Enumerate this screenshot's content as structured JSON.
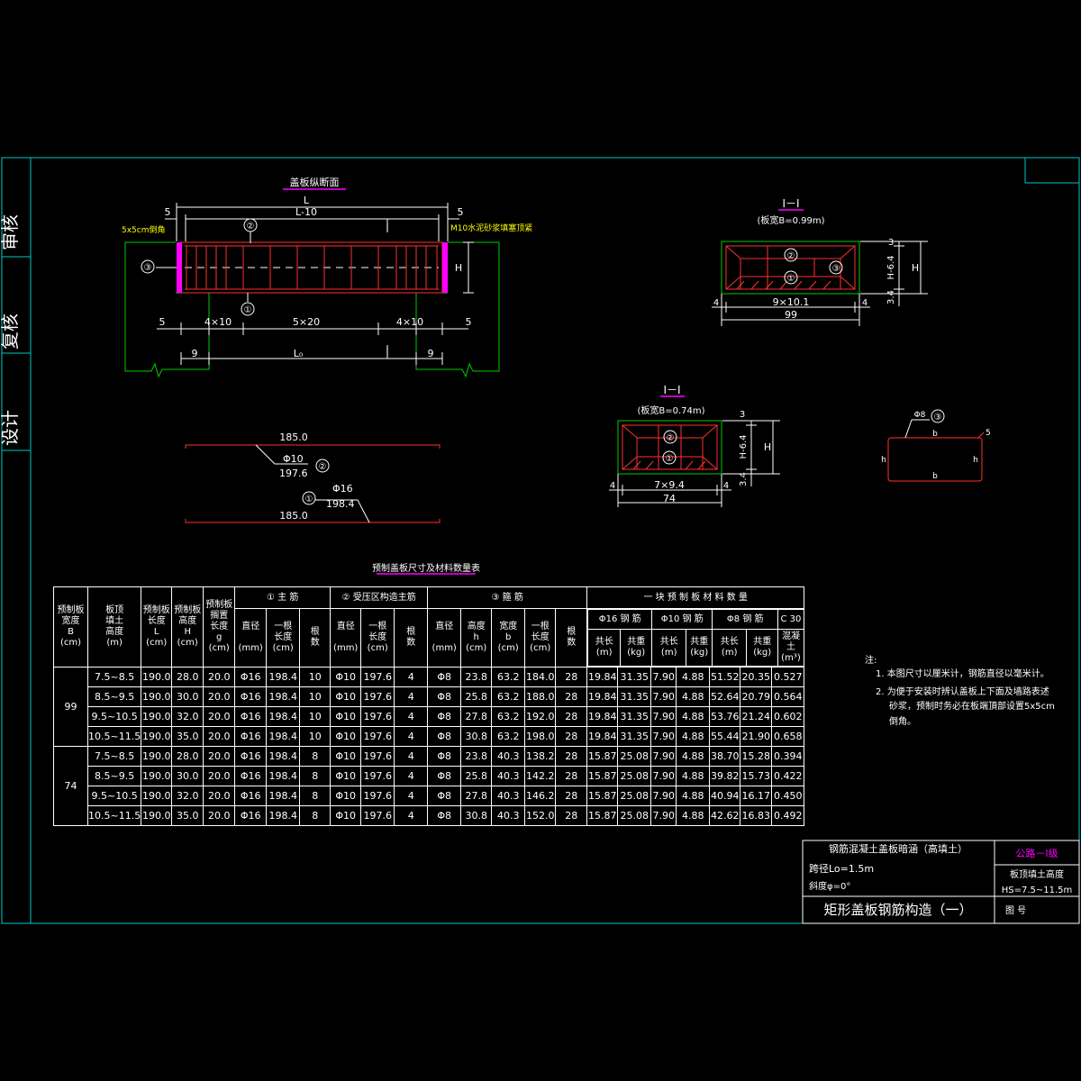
{
  "sidebar": {
    "review": "审核",
    "recheck": "复核",
    "design": "设计"
  },
  "longitudinal": {
    "title": "盖板纵断面",
    "L": "L",
    "L_minus_10": "L-10",
    "left_5": "5",
    "right_5": "5",
    "chamfer_note": "5x5cm倒角",
    "mortar_note": "M10水泥砂浆填塞顶紧",
    "section_mark": "I",
    "H": "H",
    "c1": "①",
    "c2": "②",
    "c3": "③",
    "dim_5a": "5",
    "dim_4x10a": "4×10",
    "dim_5x20": "5×20",
    "dim_4x10b": "4×10",
    "dim_5b": "5",
    "dim_9a": "9",
    "dim_L0": "L₀",
    "dim_9b": "9"
  },
  "sectionA": {
    "title": "I－I",
    "width_note": "(板宽B=0.99m)",
    "d3": "3",
    "dH64": "H-6.4",
    "d34": "3.4",
    "dH": "H",
    "d4a": "4",
    "d9x101": "9×10.1",
    "d4b": "4",
    "d99": "99",
    "c1": "①",
    "c2": "②",
    "c3": "③"
  },
  "sectionB": {
    "title": "I－I",
    "width_note": "(板宽B=0.74m)",
    "d3": "3",
    "dH64": "H-6.4",
    "d34": "3.4",
    "dH": "H",
    "d4a": "4",
    "d7x94": "7×9.4",
    "d4b": "4",
    "d74": "74",
    "c1": "①",
    "c2": "②"
  },
  "bars": {
    "b185a": "185.0",
    "b185b": "185.0",
    "phi10": "Φ10",
    "l1976": "197.6",
    "c2": "②",
    "phi16": "Φ16",
    "l1984": "198.4",
    "c1": "①"
  },
  "stirrup": {
    "phi8": "Φ8",
    "c3": "③",
    "b_top": "b",
    "b_bottom": "b",
    "h_left": "h",
    "h_right": "h",
    "five": "5"
  },
  "table": {
    "title": "预制盖板尺寸及材料数量表",
    "header": {
      "col_B": [
        "预制板",
        "宽度",
        "B",
        "(cm)"
      ],
      "col_fill": [
        "板顶",
        "填土",
        "高度",
        "(m)"
      ],
      "col_L": [
        "预制板",
        "长度",
        "L",
        "(cm)"
      ],
      "col_H": [
        "预制板",
        "高度",
        "H",
        "(cm)"
      ],
      "col_g": [
        "预制板",
        "搁置",
        "长度",
        "g",
        "(cm)"
      ],
      "grp_main": "① 主 筋",
      "grp_comp": "② 受压区构造主筋",
      "grp_stir": "③ 箍 筋",
      "grp_mat": "一 块 预 制 板 材 料 数 量",
      "dia": [
        "直径",
        "(mm)"
      ],
      "len1": [
        "一根",
        "长度",
        "(cm)"
      ],
      "count": [
        "根",
        "数"
      ],
      "stir_h": [
        "高度",
        "h",
        "(cm)"
      ],
      "stir_b": [
        "宽度",
        "b",
        "(cm)"
      ],
      "m16": "Φ16  钢 筋",
      "m10": "Φ10  钢 筋",
      "m8": "Φ8  钢 筋",
      "mc": "C 30",
      "total_len": [
        "共长",
        "(m)"
      ],
      "total_wt": [
        "共重",
        "(kg)"
      ],
      "concrete": [
        "混凝土",
        "(m³)"
      ]
    },
    "groups": [
      {
        "B": "99",
        "rows": [
          [
            "7.5~8.5",
            "190.0",
            "28.0",
            "20.0",
            "Φ16",
            "198.4",
            "10",
            "Φ10",
            "197.6",
            "4",
            "Φ8",
            "23.8",
            "63.2",
            "184.0",
            "28",
            "19.84",
            "31.35",
            "7.90",
            "4.88",
            "51.52",
            "20.35",
            "0.527"
          ],
          [
            "8.5~9.5",
            "190.0",
            "30.0",
            "20.0",
            "Φ16",
            "198.4",
            "10",
            "Φ10",
            "197.6",
            "4",
            "Φ8",
            "25.8",
            "63.2",
            "188.0",
            "28",
            "19.84",
            "31.35",
            "7.90",
            "4.88",
            "52.64",
            "20.79",
            "0.564"
          ],
          [
            "9.5~10.5",
            "190.0",
            "32.0",
            "20.0",
            "Φ16",
            "198.4",
            "10",
            "Φ10",
            "197.6",
            "4",
            "Φ8",
            "27.8",
            "63.2",
            "192.0",
            "28",
            "19.84",
            "31.35",
            "7.90",
            "4.88",
            "53.76",
            "21.24",
            "0.602"
          ],
          [
            "10.5~11.5",
            "190.0",
            "35.0",
            "20.0",
            "Φ16",
            "198.4",
            "10",
            "Φ10",
            "197.6",
            "4",
            "Φ8",
            "30.8",
            "63.2",
            "198.0",
            "28",
            "19.84",
            "31.35",
            "7.90",
            "4.88",
            "55.44",
            "21.90",
            "0.658"
          ]
        ]
      },
      {
        "B": "74",
        "rows": [
          [
            "7.5~8.5",
            "190.0",
            "28.0",
            "20.0",
            "Φ16",
            "198.4",
            "8",
            "Φ10",
            "197.6",
            "4",
            "Φ8",
            "23.8",
            "40.3",
            "138.2",
            "28",
            "15.87",
            "25.08",
            "7.90",
            "4.88",
            "38.70",
            "15.28",
            "0.394"
          ],
          [
            "8.5~9.5",
            "190.0",
            "30.0",
            "20.0",
            "Φ16",
            "198.4",
            "8",
            "Φ10",
            "197.6",
            "4",
            "Φ8",
            "25.8",
            "40.3",
            "142.2",
            "28",
            "15.87",
            "25.08",
            "7.90",
            "4.88",
            "39.82",
            "15.73",
            "0.422"
          ],
          [
            "9.5~10.5",
            "190.0",
            "32.0",
            "20.0",
            "Φ16",
            "198.4",
            "8",
            "Φ10",
            "197.6",
            "4",
            "Φ8",
            "27.8",
            "40.3",
            "146.2",
            "28",
            "15.87",
            "25.08",
            "7.90",
            "4.88",
            "40.94",
            "16.17",
            "0.450"
          ],
          [
            "10.5~11.5",
            "190.0",
            "35.0",
            "20.0",
            "Φ16",
            "198.4",
            "8",
            "Φ10",
            "197.6",
            "4",
            "Φ8",
            "30.8",
            "40.3",
            "152.0",
            "28",
            "15.87",
            "25.08",
            "7.90",
            "4.88",
            "42.62",
            "16.83",
            "0.492"
          ]
        ]
      }
    ]
  },
  "notes": {
    "title": "注:",
    "n1": "1. 本图尺寸以厘米计，钢筋直径以毫米计。",
    "n2a": "2. 为便于安装时辨认盖板上下面及墙路表述",
    "n2b": "砂浆，预制时务必在板端頂部设置5x5cm",
    "n2c": "倒角。"
  },
  "titleblock": {
    "project": "钢筋混凝土盖板暗涵（高填土）",
    "span": "跨径Lo=1.5m",
    "skew": "斜度φ=0°",
    "road_class": "公路－Ⅰ级",
    "fill_label": "板顶填土高度",
    "fill_range": "HS=7.5~11.5m",
    "drawing_title": "矩形盖板钢筋构造（一）",
    "drawing_no": "图 号"
  },
  "colors": {
    "frame": "#00c8c8",
    "green": "#00cc00",
    "red": "#ff3030",
    "magenta": "#ff00ff",
    "yellow": "#ffff00",
    "white": "#ffffff"
  }
}
